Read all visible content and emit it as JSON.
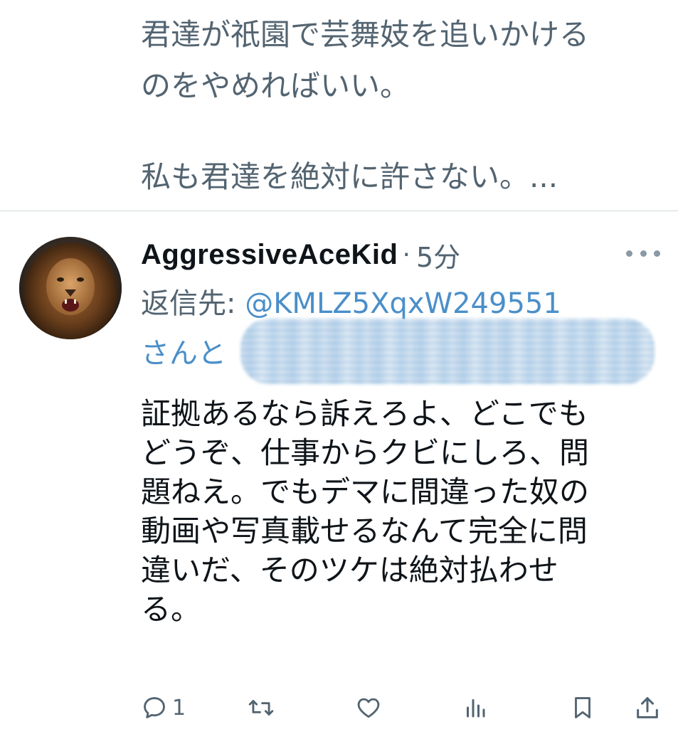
{
  "previous_tweet": {
    "lines": [
      "君達が祇園で芸舞妓を追いかける",
      "のをやめればいい。",
      "私も君達を絶対に許さない。..."
    ]
  },
  "tweet": {
    "display_name": "AggressiveAceKid",
    "separator": "·",
    "time": "5分",
    "reply_label": "返信先: ",
    "reply_mention": "@KMLZ5XqxW249551",
    "reply_suffix": "さんと",
    "body_lines": [
      "証拠あるなら訴えろよ、どこでも",
      "どうぞ、仕事からクビにしろ、問",
      "題ねえ。でもデマに間違った奴の",
      "動画や写真載せるなんて完全に問",
      "違いだ、そのツケは絶対払わせ",
      "る。"
    ],
    "reply_count": "1"
  },
  "icons": {
    "reply": "comment-bubble-icon",
    "retweet": "retweet-icon",
    "like": "heart-icon",
    "views": "analytics-bars-icon",
    "bookmark": "bookmark-icon",
    "share": "share-upload-icon",
    "more": "more-horizontal-icon"
  },
  "colors": {
    "text_primary": "#0f1419",
    "text_secondary": "#536471",
    "link": "#4a8fc9",
    "divider": "#cfd9de"
  }
}
